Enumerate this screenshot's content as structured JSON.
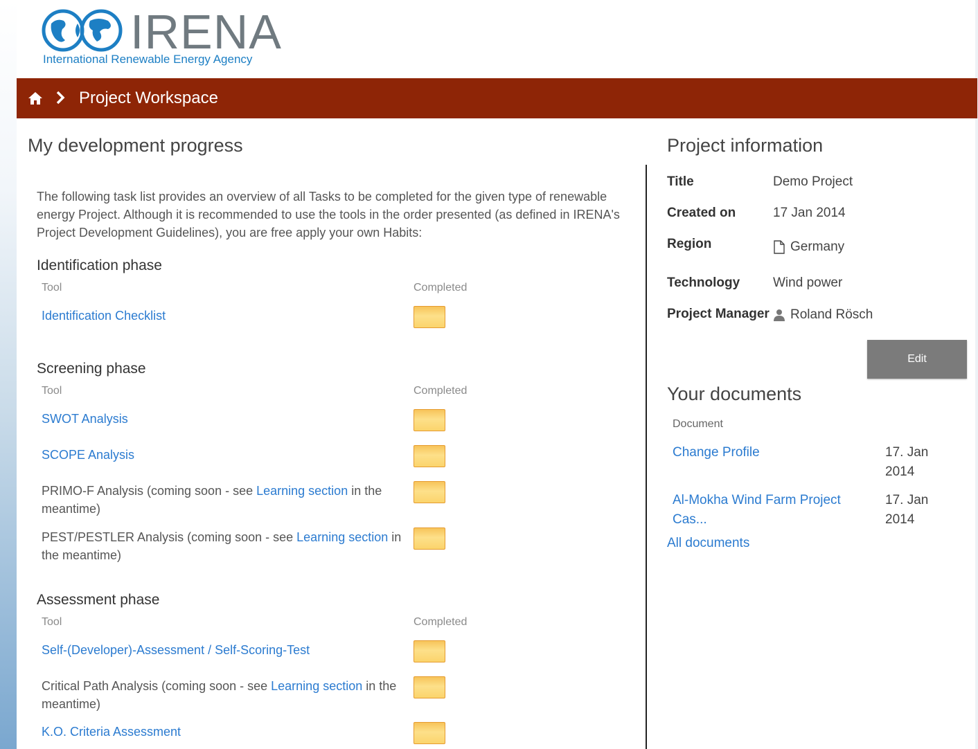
{
  "header": {
    "logo_word": "IRENA",
    "logo_subtitle": "International Renewable Energy Agency",
    "breadcrumb": "Project Workspace"
  },
  "progress": {
    "title": "My development progress",
    "intro": "The following task list provides an overview of all Tasks to be completed for the given type of renewable energy Project. Although it is recommended to use the tools in the order presented (as defined in IRENA's Project Development Guidelines), you are free apply your own Habits:",
    "col_tool": "Tool",
    "col_completed": "Completed",
    "phases": [
      {
        "title": "Identification phase",
        "tools": [
          {
            "link": "Identification Checklist"
          }
        ]
      },
      {
        "title": "Screening phase",
        "tools": [
          {
            "link": "SWOT Analysis"
          },
          {
            "link": "SCOPE Analysis"
          },
          {
            "pre": "PRIMO-F Analysis (coming soon - see ",
            "link": "Learning section",
            "post": " in the meantime)"
          },
          {
            "pre": "PEST/PESTLER Analysis (coming soon - see ",
            "link": "Learning section",
            "post": " in the meantime)"
          }
        ]
      },
      {
        "title": "Assessment phase",
        "tools": [
          {
            "link": "Self-(Developer)-Assessment / Self-Scoring-Test"
          },
          {
            "pre": "Critical Path Analysis (coming soon - see ",
            "link": "Learning section",
            "post": " in the meantime)"
          },
          {
            "link": "K.O. Criteria Assessment"
          }
        ]
      }
    ]
  },
  "project_info": {
    "title": "Project information",
    "rows": [
      {
        "label": "Title",
        "value": "Demo Project"
      },
      {
        "label": "Created on",
        "value": "17 Jan 2014"
      },
      {
        "label": "Region",
        "value": "Germany",
        "icon": "document-icon"
      },
      {
        "label": "Technology",
        "value": "Wind power"
      },
      {
        "label": "Project Manager",
        "value": "Roland Rösch",
        "icon": "user-icon"
      }
    ],
    "edit_label": "Edit"
  },
  "documents": {
    "title": "Your documents",
    "col_document": "Document",
    "items": [
      {
        "name": "Change Profile",
        "date": "17. Jan 2014"
      },
      {
        "name": "Al-Mokha Wind Farm Project Cas...",
        "date": "17. Jan 2014"
      }
    ],
    "all_label": "All documents"
  },
  "colors": {
    "brand_bar": "#8e2506",
    "link": "#2b7bd0",
    "checkbox": "#fbd46c",
    "edit_button": "#7b7b7b"
  }
}
